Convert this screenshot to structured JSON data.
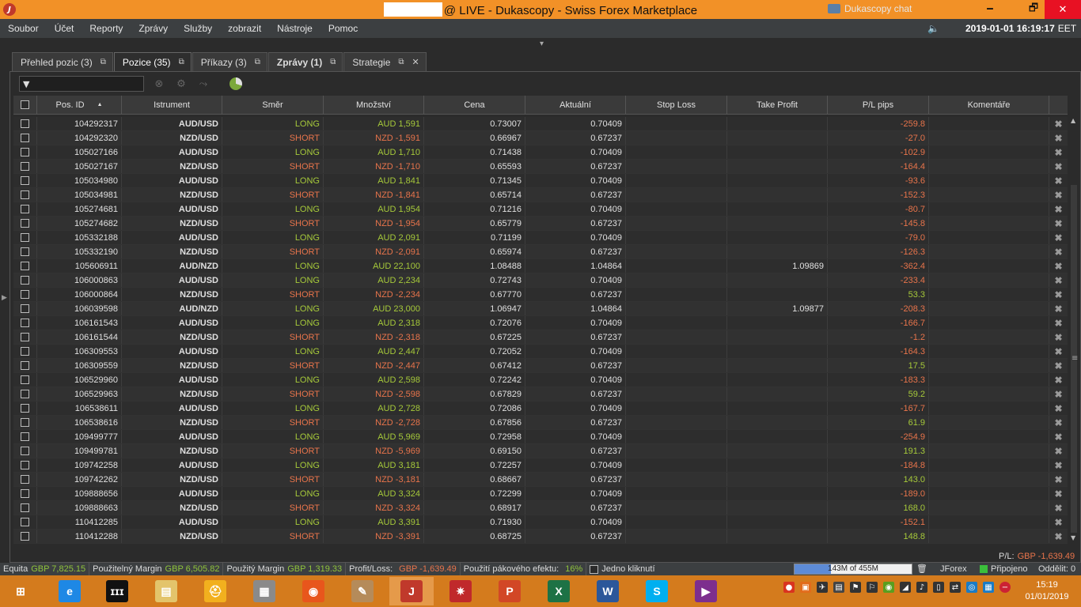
{
  "window": {
    "title": "@ LIVE - Dukascopy - Swiss Forex Marketplace",
    "min_glyph": "🗕",
    "max_glyph": "🗗",
    "close_glyph": "✕",
    "logo_glyph": "J"
  },
  "menu": {
    "items": [
      "Soubor",
      "Účet",
      "Reporty",
      "Zprávy",
      "Služby",
      "zobrazit",
      "Nástroje",
      "Pomoc"
    ],
    "chat_label": "Dukascopy chat",
    "clock": "2019-01-01 16:19:17",
    "timezone": "EET"
  },
  "tabs": [
    {
      "label": "Přehled pozic (3)",
      "popout": "⧉",
      "close": ""
    },
    {
      "label": "Pozice (35)",
      "popout": "⧉",
      "close": ""
    },
    {
      "label": "Příkazy (3)",
      "popout": "⧉",
      "close": ""
    },
    {
      "label": "Zprávy (1)",
      "popout": "⧉",
      "close": ""
    },
    {
      "label": "Strategie",
      "popout": "⧉",
      "close": "✕"
    }
  ],
  "toolbar": {
    "filter_placeholder": "",
    "filter_icon": "funnel-icon",
    "icons": [
      "close-all-icon",
      "settings-icon",
      "merge-icon",
      "pie-chart-icon"
    ]
  },
  "columns": [
    "Pos. ID",
    "Istrument",
    "Směr",
    "Množství",
    "Cena",
    "Aktuální",
    "Stop Loss",
    "Take Profit",
    "P/L pips",
    "Komentáře"
  ],
  "sort_indicator": "▲",
  "rows": [
    {
      "id": "104292317",
      "instrument": "AUD/USD",
      "dir": "LONG",
      "qty": "AUD 1,591",
      "price": "0.73007",
      "current": "0.70409",
      "sl": "",
      "tp": "",
      "pips": "-259.8"
    },
    {
      "id": "104292320",
      "instrument": "NZD/USD",
      "dir": "SHORT",
      "qty": "NZD -1,591",
      "price": "0.66967",
      "current": "0.67237",
      "sl": "",
      "tp": "",
      "pips": "-27.0"
    },
    {
      "id": "105027166",
      "instrument": "AUD/USD",
      "dir": "LONG",
      "qty": "AUD 1,710",
      "price": "0.71438",
      "current": "0.70409",
      "sl": "",
      "tp": "",
      "pips": "-102.9"
    },
    {
      "id": "105027167",
      "instrument": "NZD/USD",
      "dir": "SHORT",
      "qty": "NZD -1,710",
      "price": "0.65593",
      "current": "0.67237",
      "sl": "",
      "tp": "",
      "pips": "-164.4"
    },
    {
      "id": "105034980",
      "instrument": "AUD/USD",
      "dir": "LONG",
      "qty": "AUD 1,841",
      "price": "0.71345",
      "current": "0.70409",
      "sl": "",
      "tp": "",
      "pips": "-93.6"
    },
    {
      "id": "105034981",
      "instrument": "NZD/USD",
      "dir": "SHORT",
      "qty": "NZD -1,841",
      "price": "0.65714",
      "current": "0.67237",
      "sl": "",
      "tp": "",
      "pips": "-152.3"
    },
    {
      "id": "105274681",
      "instrument": "AUD/USD",
      "dir": "LONG",
      "qty": "AUD 1,954",
      "price": "0.71216",
      "current": "0.70409",
      "sl": "",
      "tp": "",
      "pips": "-80.7"
    },
    {
      "id": "105274682",
      "instrument": "NZD/USD",
      "dir": "SHORT",
      "qty": "NZD -1,954",
      "price": "0.65779",
      "current": "0.67237",
      "sl": "",
      "tp": "",
      "pips": "-145.8"
    },
    {
      "id": "105332188",
      "instrument": "AUD/USD",
      "dir": "LONG",
      "qty": "AUD 2,091",
      "price": "0.71199",
      "current": "0.70409",
      "sl": "",
      "tp": "",
      "pips": "-79.0"
    },
    {
      "id": "105332190",
      "instrument": "NZD/USD",
      "dir": "SHORT",
      "qty": "NZD -2,091",
      "price": "0.65974",
      "current": "0.67237",
      "sl": "",
      "tp": "",
      "pips": "-126.3"
    },
    {
      "id": "105606911",
      "instrument": "AUD/NZD",
      "dir": "LONG",
      "qty": "AUD 22,100",
      "price": "1.08488",
      "current": "1.04864",
      "sl": "",
      "tp": "1.09869",
      "pips": "-362.4"
    },
    {
      "id": "106000863",
      "instrument": "AUD/USD",
      "dir": "LONG",
      "qty": "AUD 2,234",
      "price": "0.72743",
      "current": "0.70409",
      "sl": "",
      "tp": "",
      "pips": "-233.4"
    },
    {
      "id": "106000864",
      "instrument": "NZD/USD",
      "dir": "SHORT",
      "qty": "NZD -2,234",
      "price": "0.67770",
      "current": "0.67237",
      "sl": "",
      "tp": "",
      "pips": "53.3"
    },
    {
      "id": "106039598",
      "instrument": "AUD/NZD",
      "dir": "LONG",
      "qty": "AUD 23,000",
      "price": "1.06947",
      "current": "1.04864",
      "sl": "",
      "tp": "1.09877",
      "pips": "-208.3"
    },
    {
      "id": "106161543",
      "instrument": "AUD/USD",
      "dir": "LONG",
      "qty": "AUD 2,318",
      "price": "0.72076",
      "current": "0.70409",
      "sl": "",
      "tp": "",
      "pips": "-166.7"
    },
    {
      "id": "106161544",
      "instrument": "NZD/USD",
      "dir": "SHORT",
      "qty": "NZD -2,318",
      "price": "0.67225",
      "current": "0.67237",
      "sl": "",
      "tp": "",
      "pips": "-1.2"
    },
    {
      "id": "106309553",
      "instrument": "AUD/USD",
      "dir": "LONG",
      "qty": "AUD 2,447",
      "price": "0.72052",
      "current": "0.70409",
      "sl": "",
      "tp": "",
      "pips": "-164.3"
    },
    {
      "id": "106309559",
      "instrument": "NZD/USD",
      "dir": "SHORT",
      "qty": "NZD -2,447",
      "price": "0.67412",
      "current": "0.67237",
      "sl": "",
      "tp": "",
      "pips": "17.5"
    },
    {
      "id": "106529960",
      "instrument": "AUD/USD",
      "dir": "LONG",
      "qty": "AUD 2,598",
      "price": "0.72242",
      "current": "0.70409",
      "sl": "",
      "tp": "",
      "pips": "-183.3"
    },
    {
      "id": "106529963",
      "instrument": "NZD/USD",
      "dir": "SHORT",
      "qty": "NZD -2,598",
      "price": "0.67829",
      "current": "0.67237",
      "sl": "",
      "tp": "",
      "pips": "59.2"
    },
    {
      "id": "106538611",
      "instrument": "AUD/USD",
      "dir": "LONG",
      "qty": "AUD 2,728",
      "price": "0.72086",
      "current": "0.70409",
      "sl": "",
      "tp": "",
      "pips": "-167.7"
    },
    {
      "id": "106538616",
      "instrument": "NZD/USD",
      "dir": "SHORT",
      "qty": "NZD -2,728",
      "price": "0.67856",
      "current": "0.67237",
      "sl": "",
      "tp": "",
      "pips": "61.9"
    },
    {
      "id": "109499777",
      "instrument": "AUD/USD",
      "dir": "LONG",
      "qty": "AUD 5,969",
      "price": "0.72958",
      "current": "0.70409",
      "sl": "",
      "tp": "",
      "pips": "-254.9"
    },
    {
      "id": "109499781",
      "instrument": "NZD/USD",
      "dir": "SHORT",
      "qty": "NZD -5,969",
      "price": "0.69150",
      "current": "0.67237",
      "sl": "",
      "tp": "",
      "pips": "191.3"
    },
    {
      "id": "109742258",
      "instrument": "AUD/USD",
      "dir": "LONG",
      "qty": "AUD 3,181",
      "price": "0.72257",
      "current": "0.70409",
      "sl": "",
      "tp": "",
      "pips": "-184.8"
    },
    {
      "id": "109742262",
      "instrument": "NZD/USD",
      "dir": "SHORT",
      "qty": "NZD -3,181",
      "price": "0.68667",
      "current": "0.67237",
      "sl": "",
      "tp": "",
      "pips": "143.0"
    },
    {
      "id": "109888656",
      "instrument": "AUD/USD",
      "dir": "LONG",
      "qty": "AUD 3,324",
      "price": "0.72299",
      "current": "0.70409",
      "sl": "",
      "tp": "",
      "pips": "-189.0"
    },
    {
      "id": "109888663",
      "instrument": "NZD/USD",
      "dir": "SHORT",
      "qty": "NZD -3,324",
      "price": "0.68917",
      "current": "0.67237",
      "sl": "",
      "tp": "",
      "pips": "168.0"
    },
    {
      "id": "110412285",
      "instrument": "AUD/USD",
      "dir": "LONG",
      "qty": "AUD 3,391",
      "price": "0.71930",
      "current": "0.70409",
      "sl": "",
      "tp": "",
      "pips": "-152.1"
    },
    {
      "id": "110412288",
      "instrument": "NZD/USD",
      "dir": "SHORT",
      "qty": "NZD -3,391",
      "price": "0.68725",
      "current": "0.67237",
      "sl": "",
      "tp": "",
      "pips": "148.8"
    }
  ],
  "row_close_glyph": "✖",
  "summary": {
    "label": "P/L:",
    "value": "GBP -1,639.49"
  },
  "status": {
    "equity_label": "Equita",
    "equity_value": "GBP 7,825.15",
    "usable_label": "Použitelný Margin",
    "usable_value": "GBP 6,505.82",
    "used_label": "Použitý Margin",
    "used_value": "GBP 1,319.33",
    "pl_label": "Profit/Loss:",
    "pl_value": "GBP -1,639.49",
    "leverage_label": "Použití pákového efektu:",
    "leverage_value": "16%",
    "oneclick_label": "Jedno kliknutí",
    "memory_text": "143M of 455M",
    "memory_fraction": 0.314,
    "platform": "JForex",
    "connection": "Připojeno",
    "detach": "Oddělit: 0"
  },
  "taskbar": {
    "apps": [
      "windows-start-icon",
      "internet-explorer-icon",
      "jforex-terminal-icon",
      "file-explorer-icon",
      "sirius-icon",
      "calculator-icon",
      "firefox-icon",
      "paint-icon",
      "jforex-icon",
      "network-icon",
      "powerpoint-icon",
      "excel-icon",
      "word-icon",
      "skype-icon",
      "video-editor-icon"
    ],
    "time": "15:19",
    "date": "01/01/2019"
  }
}
